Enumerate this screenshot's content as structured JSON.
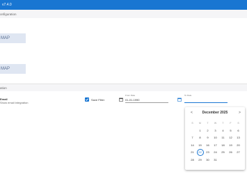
{
  "app": {
    "version": "v7.4.0"
  },
  "config": {
    "label": "onfiguration",
    "map_buttons": [
      "MAP",
      "MAP"
    ]
  },
  "section2": {
    "label": "ation"
  },
  "email": {
    "title": "Email",
    "subtitle": "Show email integration"
  },
  "save_filter": {
    "label": "Save Filter",
    "checked": true
  },
  "from_date": {
    "label": "From Date",
    "value": "01-01-1990"
  },
  "to_date": {
    "label": "To Date",
    "value": ""
  },
  "calendar": {
    "month_year": "December 2025",
    "prev": "<",
    "next": ">",
    "weekdays": [
      "S",
      "M",
      "T",
      "W",
      "T",
      "F",
      "S"
    ],
    "weeks": [
      [
        "",
        "1",
        "2",
        "3",
        "4",
        "5",
        "6"
      ],
      [
        "7",
        "8",
        "9",
        "10",
        "11",
        "12",
        "13"
      ],
      [
        "14",
        "15",
        "16",
        "17",
        "18",
        "19",
        "20"
      ],
      [
        "21",
        "22",
        "23",
        "24",
        "25",
        "26",
        "27"
      ],
      [
        "28",
        "29",
        "30",
        "31",
        "",
        "",
        ""
      ]
    ],
    "today": "22",
    "accent": "#1976d2"
  }
}
